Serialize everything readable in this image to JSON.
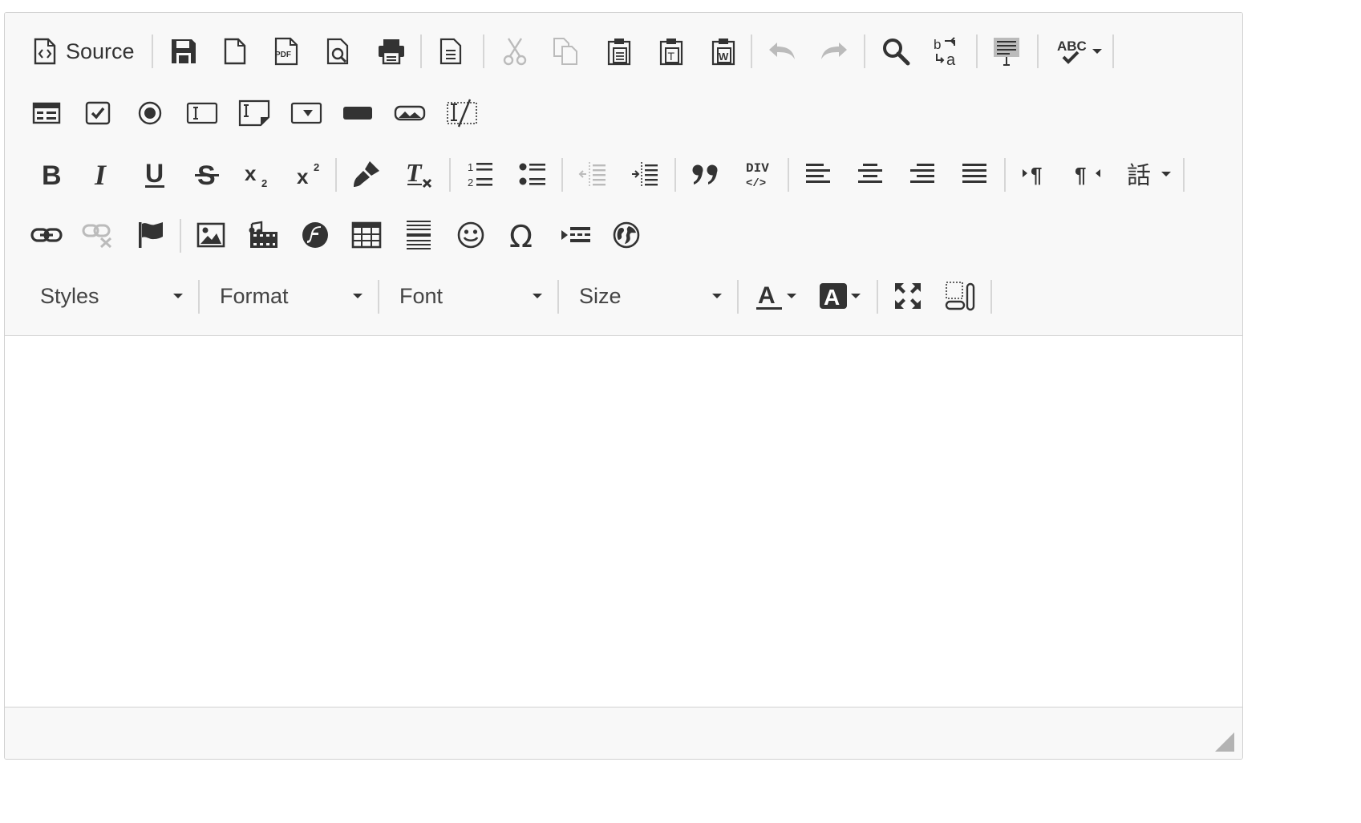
{
  "toolbar": {
    "source_label": "Source",
    "styles_label": "Styles",
    "format_label": "Format",
    "font_label": "Font",
    "size_label": "Size"
  },
  "icons": {
    "row1": [
      "source-icon",
      "save-icon",
      "new-page-icon",
      "export-pdf-icon",
      "preview-icon",
      "print-icon",
      "templates-icon",
      "cut-icon",
      "copy-icon",
      "paste-icon",
      "paste-text-icon",
      "paste-word-icon",
      "undo-icon",
      "redo-icon",
      "find-icon",
      "replace-icon",
      "select-all-icon",
      "spellcheck-icon"
    ],
    "row2": [
      "form-icon",
      "checkbox-icon",
      "radio-icon",
      "text-field-icon",
      "textarea-icon",
      "select-icon",
      "button-icon",
      "image-button-icon",
      "hidden-field-icon"
    ],
    "row3": [
      "bold-icon",
      "italic-icon",
      "underline-icon",
      "strike-icon",
      "subscript-icon",
      "superscript-icon",
      "copy-format-icon",
      "remove-format-icon",
      "numbered-list-icon",
      "bulleted-list-icon",
      "outdent-icon",
      "indent-icon",
      "blockquote-icon",
      "div-icon",
      "align-left-icon",
      "align-center-icon",
      "align-right-icon",
      "justify-icon",
      "ltr-icon",
      "rtl-icon",
      "language-icon"
    ],
    "row4": [
      "link-icon",
      "unlink-icon",
      "anchor-icon",
      "image-icon",
      "media-icon",
      "flash-icon",
      "table-icon",
      "horizontal-rule-icon",
      "smiley-icon",
      "special-char-icon",
      "page-break-icon",
      "iframe-icon"
    ],
    "row5": [
      "text-color-icon",
      "background-color-icon",
      "maximize-icon",
      "show-blocks-icon"
    ]
  },
  "colors": {
    "toolbar_bg": "#f8f8f8",
    "border": "#d1d1d1",
    "icon": "#333333",
    "icon_disabled": "#bbbbbb",
    "separator": "#d6d6d6"
  }
}
